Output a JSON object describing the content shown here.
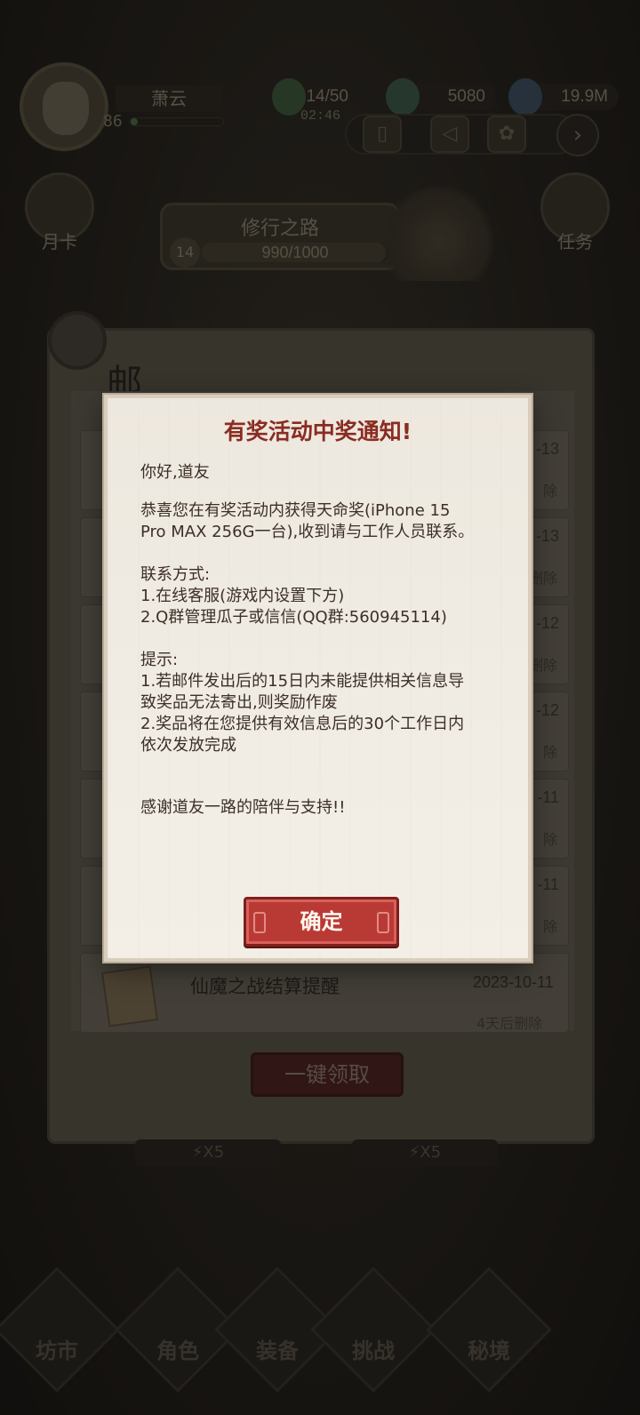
{
  "player": {
    "name": "萧云",
    "level": "86"
  },
  "resources": {
    "energy": "14/50",
    "energy_timer": "02:46",
    "jade": "5080",
    "spirit": "19.9M"
  },
  "side_buttons": {
    "monthly_card": "月卡",
    "tasks": "任务"
  },
  "journey": {
    "title": "修行之路",
    "level": "14",
    "progress": "990/1000",
    "progress_fraction": 0.99
  },
  "mail": {
    "header_char": "邮",
    "last_item": {
      "title": "仙魔之战结算提醒",
      "date": "2023-10-11",
      "expiry": "4天后删除"
    },
    "claim_all_label": "一键领取",
    "partial_rows": [
      {
        "date_tail": "-13",
        "del_tail": "除"
      },
      {
        "date_tail": "-13",
        "del_tail": "删除"
      },
      {
        "date_tail": "-12",
        "del_tail": "删除"
      },
      {
        "date_tail": "-12",
        "del_tail": "除"
      },
      {
        "date_tail": "-11",
        "del_tail": "除"
      },
      {
        "date_tail": "-11",
        "del_tail": "除"
      }
    ]
  },
  "stamina_chips": [
    "⚡X5",
    "⚡X5"
  ],
  "bottom_nav": [
    "坊市",
    "角色",
    "装备",
    "挑战",
    "秘境"
  ],
  "dialog": {
    "title": "有奖活动中奖通知!",
    "greeting": "你好,道友",
    "line1": "恭喜您在有奖活动内获得天命奖(iPhone 15",
    "line2": "Pro MAX 256G一台),收到请与工作人员联系。",
    "contact_header": "联系方式:",
    "contact1": "1.在线客服(游戏内设置下方)",
    "contact2": "2.Q群管理瓜子或信信(QQ群:560945114)",
    "tips_header": "提示:",
    "tip1a": "1.若邮件发出后的15日内未能提供相关信息导",
    "tip1b": "致奖品无法寄出,则奖励作废",
    "tip2a": "2.奖品将在您提供有效信息后的30个工作日内",
    "tip2b": "依次发放完成",
    "thanks": "感谢道友一路的陪伴与支持!!",
    "confirm_label": "确定"
  }
}
